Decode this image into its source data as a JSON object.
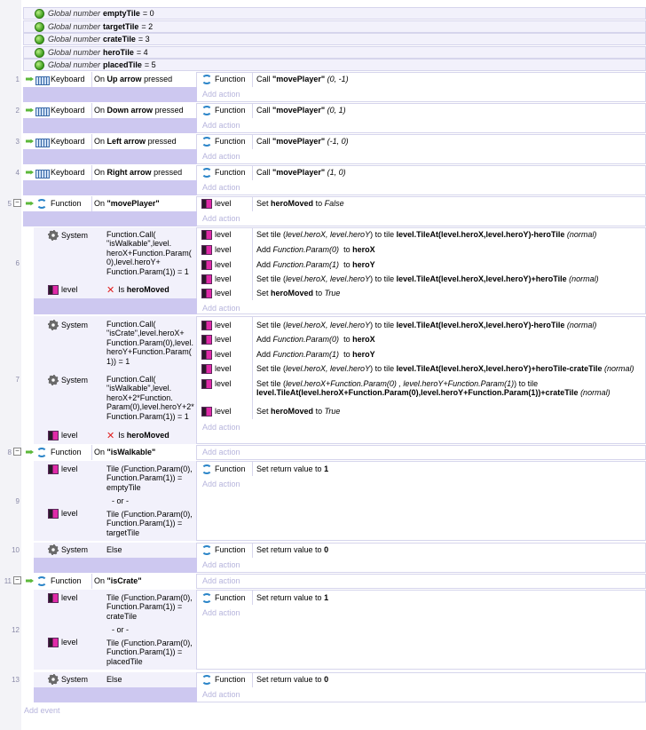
{
  "globals": [
    {
      "prefix": "Global number",
      "name": "emptyTile",
      "value": "= 0"
    },
    {
      "prefix": "Global number",
      "name": "targetTile",
      "value": "= 2"
    },
    {
      "prefix": "Global number",
      "name": "crateTile",
      "value": "= 3"
    },
    {
      "prefix": "Global number",
      "name": "heroTile",
      "value": "= 4"
    },
    {
      "prefix": "Global number",
      "name": "placedTile",
      "value": "= 5"
    }
  ],
  "labels": {
    "keyboard": "Keyboard",
    "function": "Function",
    "system": "System",
    "level": "level",
    "add_action": "Add action",
    "add_event": "Add event",
    "or": "- or -",
    "else": "Else",
    "on": "On",
    "pressed": "pressed",
    "is": "Is",
    "is_hero_moved": "heroMoved"
  },
  "events": {
    "e1": {
      "num": "1",
      "key": "Up arrow",
      "call": "Call",
      "fn": "\"movePlayer\"",
      "args": "(0, -1)"
    },
    "e2": {
      "num": "2",
      "key": "Down arrow",
      "call": "Call",
      "fn": "\"movePlayer\"",
      "args": "(0, 1)"
    },
    "e3": {
      "num": "3",
      "key": "Left arrow",
      "call": "Call",
      "fn": "\"movePlayer\"",
      "args": "(-1, 0)"
    },
    "e4": {
      "num": "4",
      "key": "Right arrow",
      "call": "Call",
      "fn": "\"movePlayer\"",
      "args": "(1, 0)"
    },
    "e5": {
      "num": "5",
      "name": "\"movePlayer\"",
      "action_pre": "Set",
      "action_var": "heroMoved",
      "action_mid": "to",
      "action_val": "False"
    },
    "e6": {
      "num": "6",
      "cond": "Function.Call( \"isWalkable\",level. heroX+Function.Param( 0),level.heroY+ Function.Param(1)) = 1",
      "a1_pre": "Set tile (",
      "a1_args": "level.heroX, level.heroY",
      "a1_mid": ") to tile",
      "a1_expr": "level.TileAt(level.heroX,level.heroY)-heroTile",
      "a1_post": "(normal)",
      "a2_pre": "Add",
      "a2_arg": "Function.Param(0)",
      "a2_mid": "to",
      "a2_var": "heroX",
      "a3_pre": "Add",
      "a3_arg": "Function.Param(1)",
      "a3_mid": "to",
      "a3_var": "heroY",
      "a4_pre": "Set tile (",
      "a4_args": "level.heroX, level.heroY",
      "a4_mid": ") to tile",
      "a4_expr": "level.TileAt(level.heroX,level.heroY)+heroTile",
      "a4_post": "(normal)",
      "a5_pre": "Set",
      "a5_var": "heroMoved",
      "a5_mid": "to",
      "a5_val": "True"
    },
    "e7": {
      "num": "7",
      "cond1": "Function.Call( \"isCrate\",level.heroX+ Function.Param(0),level. heroY+Function.Param( 1)) = 1",
      "cond2": "Function.Call( \"isWalkable\",level. heroX+2*Function. Param(0),level.heroY+2* Function.Param(1)) = 1",
      "a1_pre": "Set tile (",
      "a1_args": "level.heroX, level.heroY",
      "a1_mid": ") to tile",
      "a1_expr": "level.TileAt(level.heroX,level.heroY)-heroTile",
      "a1_post": "(normal)",
      "a2_pre": "Add",
      "a2_arg": "Function.Param(0)",
      "a2_mid": "to",
      "a2_var": "heroX",
      "a3_pre": "Add",
      "a3_arg": "Function.Param(1)",
      "a3_mid": "to",
      "a3_var": "heroY",
      "a4_pre": "Set tile (",
      "a4_args": "level.heroX, level.heroY",
      "a4_mid": ") to tile",
      "a4_expr": "level.TileAt(level.heroX,level.heroY)+heroTile-crateTile",
      "a4_post": "(normal)",
      "a5_pre": "Set tile (",
      "a5_args": "level.heroX+Function.Param(0) , level.heroY+Function.Param(1)",
      "a5_mid": ") to tile",
      "a5_expr": "level.TileAt(level.heroX+Function.Param(0),level.heroY+Function.Param(1))+crateTile",
      "a5_post": "(normal)",
      "a6_pre": "Set",
      "a6_var": "heroMoved",
      "a6_mid": "to",
      "a6_val": "True"
    },
    "e8": {
      "num": "8",
      "name": "\"isWalkable\""
    },
    "e9": {
      "num": "9",
      "cond1": "Tile (Function.Param(0), Function.Param(1)) = emptyTile",
      "cond2": "Tile (Function.Param(0), Function.Param(1)) = targetTile",
      "action_pre": "Set return value to",
      "action_val": "1"
    },
    "e10": {
      "num": "10",
      "action_pre": "Set return value to",
      "action_val": "0"
    },
    "e11": {
      "num": "11",
      "name": "\"isCrate\""
    },
    "e12": {
      "num": "12",
      "cond1": "Tile (Function.Param(0), Function.Param(1)) = crateTile",
      "cond2": "Tile (Function.Param(0), Function.Param(1)) = placedTile",
      "action_pre": "Set return value to",
      "action_val": "1"
    },
    "e13": {
      "num": "13",
      "action_pre": "Set return value to",
      "action_val": "0"
    }
  }
}
